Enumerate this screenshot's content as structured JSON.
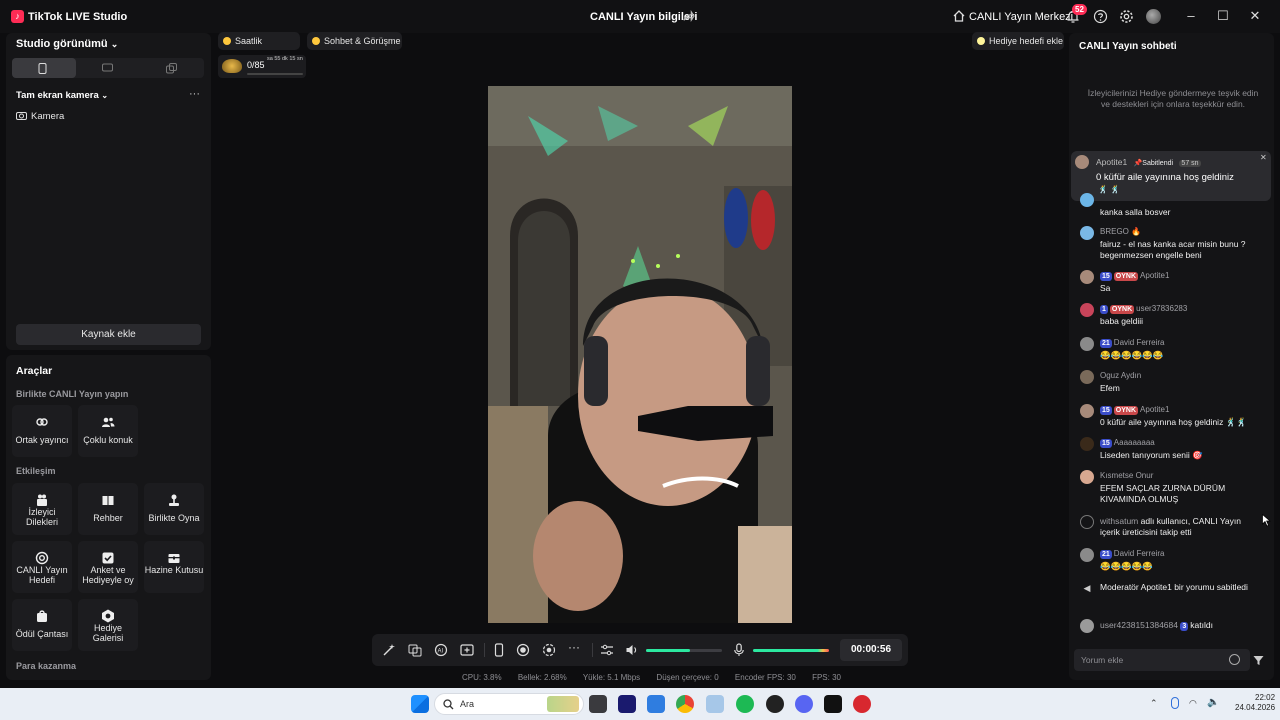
{
  "titlebar": {
    "app_name": "TikTok LIVE Studio",
    "center_title": "CANLI Yayın bilgileri",
    "live_center": "CANLI Yayın Merkezi",
    "notif_count": "52"
  },
  "studio": {
    "title": "Studio görünümü",
    "camera_section": "Tam ekran kamera",
    "camera_source": "Kamera",
    "add_source": "Kaynak ekle"
  },
  "tools": {
    "title": "Araçlar",
    "group1": "Birlikte CANLI Yayın yapın",
    "group2": "Etkileşim",
    "group3": "Para kazanma",
    "items": [
      "Ortak yayıncı",
      "Çoklu konuk",
      "İzleyici Dilekleri",
      "Rehber",
      "Birlikte Oyna",
      "CANLI Yayın Hedefi",
      "Anket ve Hediyeyle oy",
      "Hazine Kutusu",
      "Ödül Çantası",
      "Hediye Galerisi"
    ]
  },
  "center": {
    "ranking": "Saatlik Sıralama",
    "chat_btn": "Sohbet & Görüşme",
    "gift_goal": "Hediye hedefi ekle",
    "goal_progress": "0/85",
    "goal_timer": "sa 55 dk 15 sn",
    "timer": "00:00:56"
  },
  "stats": {
    "cpu": "CPU: 3.8%",
    "memory": "Bellek: 2.68%",
    "upload": "Yükle: 5.1 Mbps",
    "dropped": "Düşen çerçeve: 0",
    "encoder": "Encoder FPS: 30",
    "fps": "FPS: 30"
  },
  "chat": {
    "title": "CANLI Yayın sohbeti",
    "info": "İzleyicilerinizi Hediye göndermeye teşvik edin ve destekleri için onlara teşekkür edin.",
    "pinned": {
      "user": "Apotite1",
      "tag": "Sabitlendi",
      "time": "57 sn",
      "text": "0 küfür aile yayınına hoş geldiniz"
    },
    "messages": [
      {
        "user": "",
        "level": "",
        "fan": "",
        "text": "kanka salla bosver"
      },
      {
        "user": "BREGO",
        "level": "",
        "fan": "",
        "text": "fairuz - el nas kanka acar misin bunu ? begenmezsen engelle beni"
      },
      {
        "user": "Apotite1",
        "level": "15",
        "fan": "OYNK",
        "text": "Sa"
      },
      {
        "user": "user37836283",
        "level": "1",
        "fan": "OYNK",
        "text": "baba geldiii"
      },
      {
        "user": "David Ferreira",
        "level": "21",
        "fan": "",
        "text": "😂😂😂😂😂😂"
      },
      {
        "user": "Oguz Aydın",
        "level": "",
        "fan": "",
        "text": "Efem"
      },
      {
        "user": "Apotite1",
        "level": "15",
        "fan": "OYNK",
        "text": "0 küfür aile yayınına hoş geldiniz 🕺🕺"
      },
      {
        "user": "Aaaaaaaaa",
        "level": "15",
        "fan": "",
        "text": "Liseden tanıyorum senii 🎯"
      },
      {
        "user": "Kısmetse Onur",
        "level": "",
        "fan": "",
        "text": "EFEM SAÇLAR ZURNA DÜRÜM KIVAMINDA OLMUŞ"
      },
      {
        "user": "withsatum",
        "level": "",
        "fan": "",
        "text": "adlı kullanıcı, CANLI Yayın içerik üreticisini takip etti"
      },
      {
        "user": "David Ferreira",
        "level": "21",
        "fan": "",
        "text": "😂😂😂😂😂"
      },
      {
        "user": "Moderatör",
        "level": "",
        "fan": "",
        "text": "Apotite1 bir yorumu sabitledi"
      },
      {
        "user": "user4238151384684",
        "level": "3",
        "fan": "",
        "text": "katıldı"
      }
    ],
    "input_placeholder": "Yorum ekle"
  },
  "taskbar": {
    "search": "Ara",
    "time": "22:02",
    "date": "24.04.2026"
  }
}
